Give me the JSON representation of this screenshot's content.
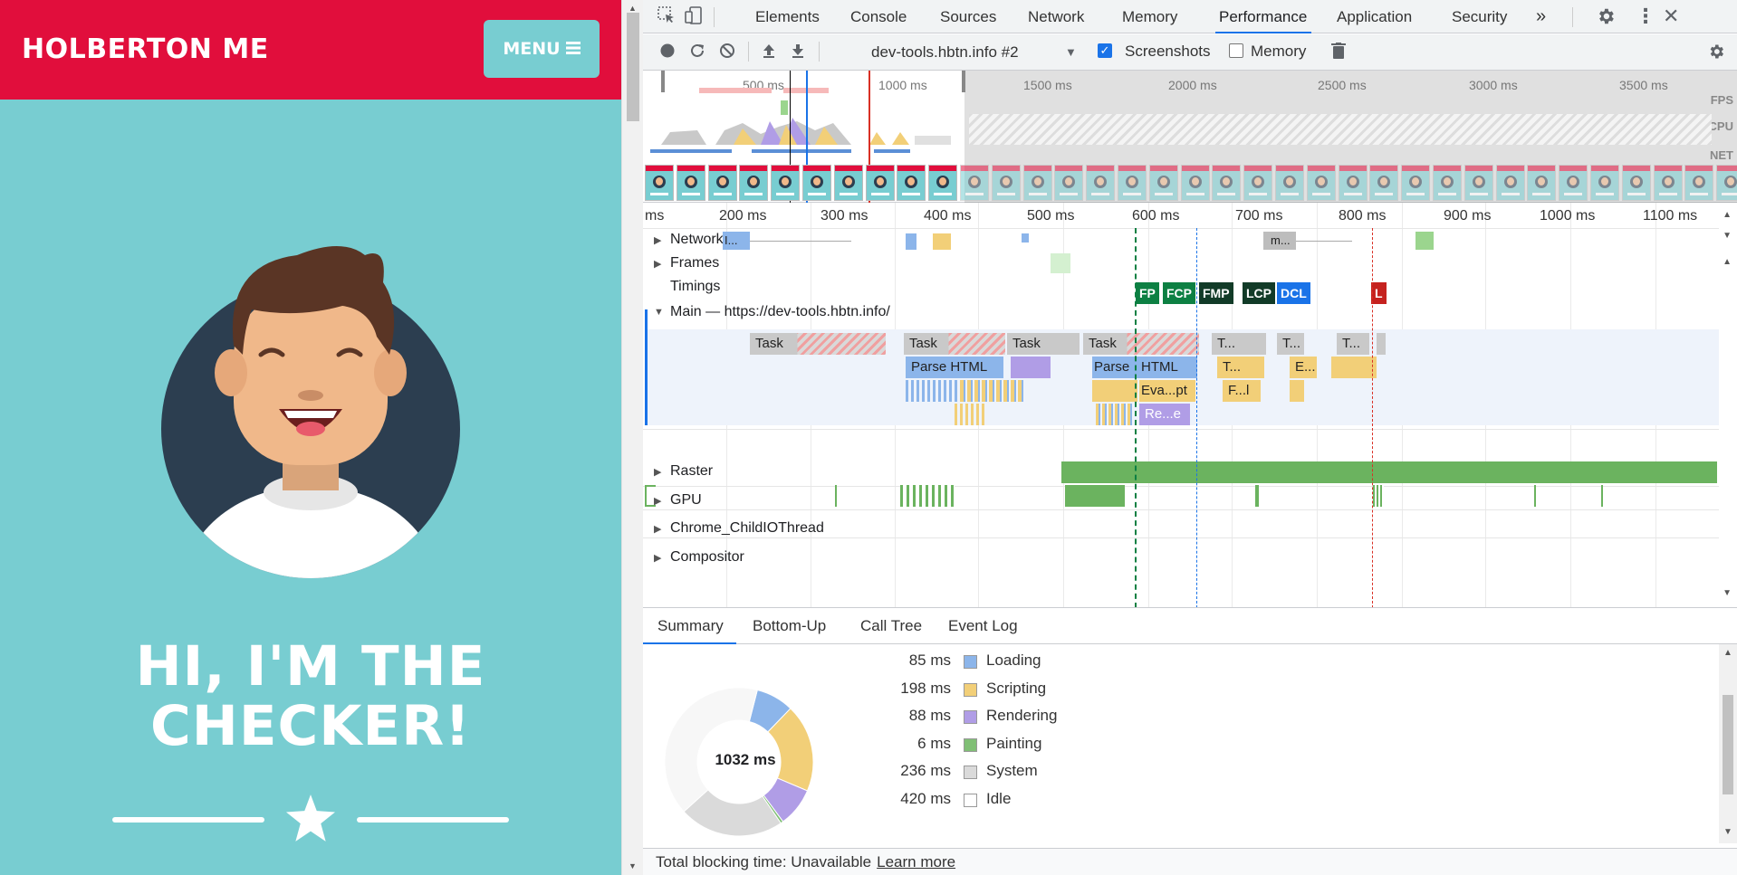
{
  "site": {
    "brand": "HOLBERTON ME",
    "menu_label": "MENU",
    "hero_line1": "HI, I'M THE",
    "hero_line2": "CHECKER!"
  },
  "devtools": {
    "tabs": [
      "Elements",
      "Console",
      "Sources",
      "Network",
      "Memory",
      "Performance",
      "Application",
      "Security"
    ],
    "active_tab": "Performance",
    "more_tabs": "»",
    "profile": "dev-tools.hbtn.info #2",
    "screenshots_label": "Screenshots",
    "screenshots_checked": true,
    "memory_label": "Memory",
    "memory_checked": false
  },
  "overview": {
    "ticks": [
      "500 ms",
      "1000 ms",
      "1500 ms",
      "2000 ms",
      "2500 ms",
      "3000 ms",
      "3500 ms"
    ],
    "side_labels": [
      "FPS",
      "CPU",
      "NET"
    ]
  },
  "flame": {
    "ticks": [
      "ms",
      "200 ms",
      "300 ms",
      "400 ms",
      "500 ms",
      "600 ms",
      "700 ms",
      "800 ms",
      "900 ms",
      "1000 ms",
      "1100 ms"
    ],
    "tracks": {
      "network": "Network",
      "frames": "Frames",
      "timings": "Timings",
      "main": "Main — https://dev-tools.hbtn.info/",
      "raster": "Raster",
      "gpu": "GPU",
      "child_io": "Chrome_ChildIOThread",
      "compositor": "Compositor"
    },
    "net_labels": [
      "I...",
      "m..."
    ],
    "timings": [
      "FP",
      "FCP",
      "FMP",
      "LCP",
      "DCL",
      "L"
    ],
    "main_blocks": {
      "task": "Task",
      "t": "T...",
      "parse_html": "Parse HTML",
      "parse": "Parse",
      "html": "HTML",
      "evaluate": "Eva...pt",
      "recalc": "Re...e",
      "e": "E...",
      "f": "F...l"
    }
  },
  "details": {
    "tabs": [
      "Summary",
      "Bottom-Up",
      "Call Tree",
      "Event Log"
    ],
    "active_tab": "Summary",
    "total": "1032 ms",
    "rows": [
      {
        "value": "85 ms",
        "name": "Loading",
        "color": "#8cb5ea"
      },
      {
        "value": "198 ms",
        "name": "Scripting",
        "color": "#f2cf78"
      },
      {
        "value": "88 ms",
        "name": "Rendering",
        "color": "#b09de6"
      },
      {
        "value": "6 ms",
        "name": "Painting",
        "color": "#80bf75"
      },
      {
        "value": "236 ms",
        "name": "System",
        "color": "#dadada"
      },
      {
        "value": "420 ms",
        "name": "Idle",
        "color": "#ffffff"
      }
    ],
    "footer_text": "Total blocking time: Unavailable",
    "footer_link": "Learn more"
  }
}
